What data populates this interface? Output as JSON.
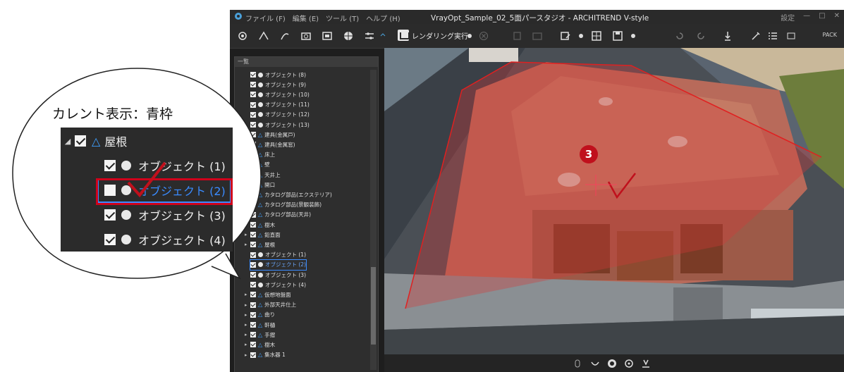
{
  "window": {
    "title": "VrayOpt_Sample_02_5面パースタジオ - ARCHITREND V-style",
    "menus": [
      "ファイル (F)",
      "編集 (E)",
      "ツール (T)",
      "ヘルプ (H)"
    ],
    "controls": [
      "設定",
      "—",
      "□",
      "✕"
    ]
  },
  "toolbar": {
    "render_label": "レンダリング実行",
    "pack_label": "PACK"
  },
  "panel": {
    "header": "一覧",
    "rows": [
      {
        "label": "オブジェクト (8)",
        "kind": "object"
      },
      {
        "label": "オブジェクト (9)",
        "kind": "object"
      },
      {
        "label": "オブジェクト (10)",
        "kind": "object"
      },
      {
        "label": "オブジェクト (11)",
        "kind": "object"
      },
      {
        "label": "オブジェクト (12)",
        "kind": "object"
      },
      {
        "label": "オブジェクト (13)",
        "kind": "object"
      },
      {
        "label": "建具(金属戸)",
        "kind": "group"
      },
      {
        "label": "建具(金属窓)",
        "kind": "group"
      },
      {
        "label": "床上",
        "kind": "group"
      },
      {
        "label": "壁",
        "kind": "group"
      },
      {
        "label": "天井上",
        "kind": "group"
      },
      {
        "label": "開口",
        "kind": "group"
      },
      {
        "label": "カタログ部品(エクステリア)",
        "kind": "group"
      },
      {
        "label": "カタログ部品(景観装飾)",
        "kind": "group"
      },
      {
        "label": "カタログ部品(天井)",
        "kind": "group"
      },
      {
        "label": "樹木",
        "kind": "group"
      },
      {
        "label": "鉛直面",
        "kind": "group"
      },
      {
        "label": "屋根",
        "kind": "group"
      },
      {
        "label": "オブジェクト (1)",
        "kind": "object"
      },
      {
        "label": "オブジェクト (2)",
        "kind": "object",
        "selected": true
      },
      {
        "label": "オブジェクト (3)",
        "kind": "object"
      },
      {
        "label": "オブジェクト (4)",
        "kind": "object"
      },
      {
        "label": "仮想地盤面",
        "kind": "group"
      },
      {
        "label": "外部天井仕上",
        "kind": "group"
      },
      {
        "label": "曲り",
        "kind": "group"
      },
      {
        "label": "軒樋",
        "kind": "group"
      },
      {
        "label": "手摺",
        "kind": "group"
      },
      {
        "label": "樹木",
        "kind": "group"
      },
      {
        "label": "集水器 1",
        "kind": "group"
      }
    ]
  },
  "callout": {
    "title": "カレント表示：青枠",
    "rows": [
      {
        "label": "屋根",
        "kind": "group"
      },
      {
        "label": "オブジェクト (1)",
        "kind": "object"
      },
      {
        "label": "オブジェクト (2)",
        "kind": "object",
        "selected": true
      },
      {
        "label": "オブジェクト (3)",
        "kind": "object"
      },
      {
        "label": "オブジェクト (4)",
        "kind": "object"
      }
    ]
  },
  "viewport": {
    "step_badge": "3"
  },
  "colors": {
    "accent_blue": "#3a8bff",
    "highlight_red": "#d0021b",
    "badge_red": "#c0101c"
  }
}
